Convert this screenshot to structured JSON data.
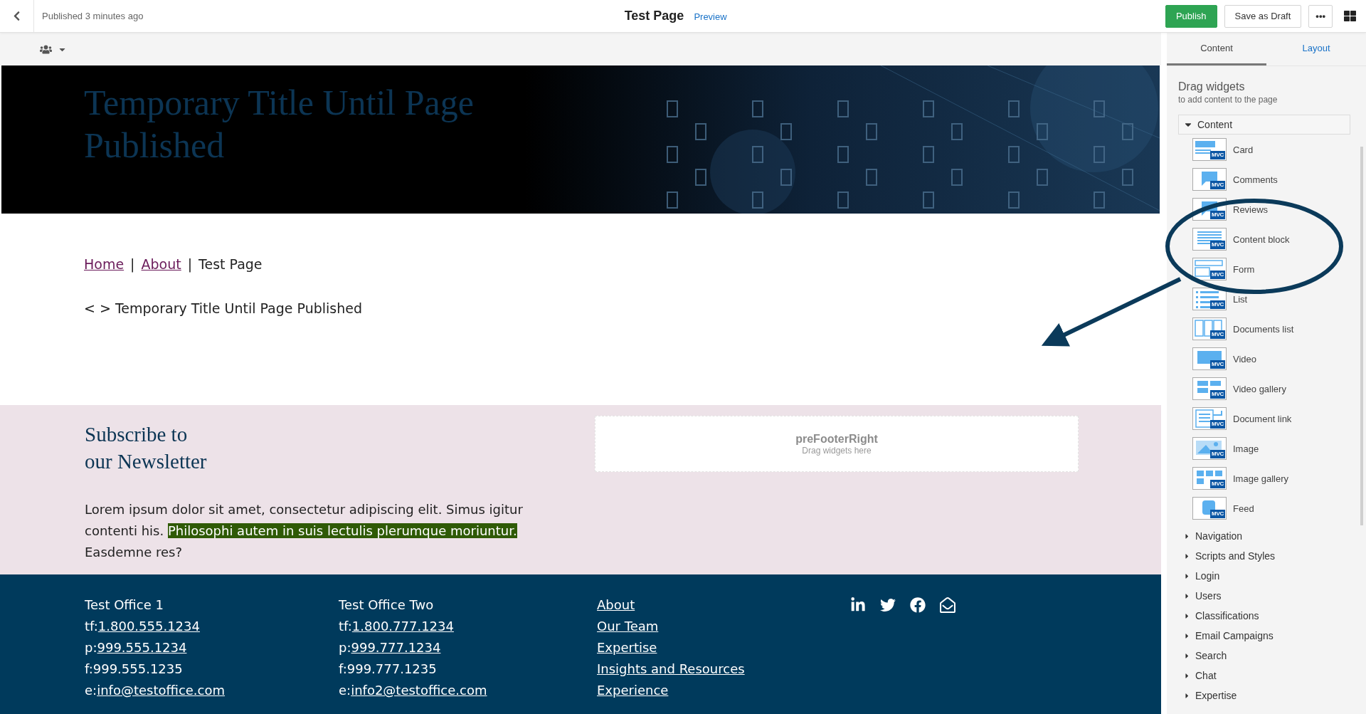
{
  "top_bar": {
    "status": "Published 3 minutes ago",
    "title": "Test Page",
    "preview_link": "Preview",
    "buttons": [
      {
        "label": "Publish",
        "kind": "primary"
      },
      {
        "label": "Save as Draft",
        "kind": "secondary"
      },
      {
        "label": "•••",
        "kind": "more"
      }
    ]
  },
  "hero": {
    "title": "Temporary Title Until Page Published"
  },
  "breadcrumb": [
    {
      "label": "Home",
      "link": true,
      "separator": "|"
    },
    {
      "label": "About",
      "link": true,
      "separator": "|"
    },
    {
      "label": "Test Page",
      "link": false
    }
  ],
  "page_heading": "< > Temporary Title Until Page Published",
  "prefooter": {
    "heading": [
      "Subscribe to",
      "our Newsletter"
    ],
    "paragraph": [
      {
        "text": "Lorem ipsum dolor sit amet, consectetur adipiscing elit. Simus igitur contenti his. ",
        "highlighted": false
      },
      {
        "text": "Philosophi autem in suis lectulis plerumque moriuntur.",
        "highlighted": true
      },
      {
        "text": " Easdemne res?",
        "highlighted": false
      }
    ],
    "drop_zone": {
      "title": "preFooterRight",
      "hint": "Drag widgets here"
    }
  },
  "footer": {
    "columns": [
      {
        "lines": [
          {
            "text": "Test Office 1"
          },
          {
            "prefix": "tf:",
            "link": "1.800.555.1234"
          },
          {
            "prefix": "p:",
            "link": "999.555.1234"
          },
          {
            "text": "f:999.555.1235"
          },
          {
            "prefix": "e:",
            "link": "info@testoffice.com"
          }
        ]
      },
      {
        "lines": [
          {
            "text": "Test Office Two"
          },
          {
            "prefix": "tf:",
            "link": "1.800.777.1234"
          },
          {
            "prefix": "p:",
            "link": "999.777.1234"
          },
          {
            "text": "f:999.777.1235"
          },
          {
            "prefix": "e:",
            "link": "info2@testoffice.com"
          }
        ]
      },
      {
        "lines": [
          {
            "link": "About"
          },
          {
            "link": "Our Team"
          },
          {
            "link": "Expertise"
          },
          {
            "link": "Insights and Resources"
          },
          {
            "link": "Experience"
          }
        ]
      }
    ]
  },
  "panel": {
    "tabs": [
      {
        "label": "Content",
        "selected": true
      },
      {
        "label": "Layout",
        "selected": false
      }
    ],
    "heading": "Drag widgets",
    "subheading": "to add content to the page",
    "categories": [
      {
        "label": "Content",
        "expanded": true,
        "widgets": [
          {
            "label": "Card",
            "badge": "MVC"
          },
          {
            "label": "Comments",
            "badge": "MVC"
          },
          {
            "label": "Reviews",
            "badge": "MVC"
          },
          {
            "label": "Content block",
            "badge": "MVC"
          },
          {
            "label": "Form",
            "badge": "MVC"
          },
          {
            "label": "List",
            "badge": "MVC"
          },
          {
            "label": "Documents list",
            "badge": "MVC"
          },
          {
            "label": "Video",
            "badge": "MVC"
          },
          {
            "label": "Video gallery",
            "badge": "MVC"
          },
          {
            "label": "Document link",
            "badge": "MVC"
          },
          {
            "label": "Image",
            "badge": "MVC"
          },
          {
            "label": "Image gallery",
            "badge": "MVC"
          },
          {
            "label": "Feed",
            "badge": "MVC"
          }
        ]
      },
      {
        "label": "Navigation",
        "expanded": false
      },
      {
        "label": "Scripts and Styles",
        "expanded": false
      },
      {
        "label": "Login",
        "expanded": false
      },
      {
        "label": "Users",
        "expanded": false
      },
      {
        "label": "Classifications",
        "expanded": false
      },
      {
        "label": "Email Campaigns",
        "expanded": false
      },
      {
        "label": "Search",
        "expanded": false
      },
      {
        "label": "Chat",
        "expanded": false
      },
      {
        "label": "Expertise",
        "expanded": false
      }
    ]
  }
}
